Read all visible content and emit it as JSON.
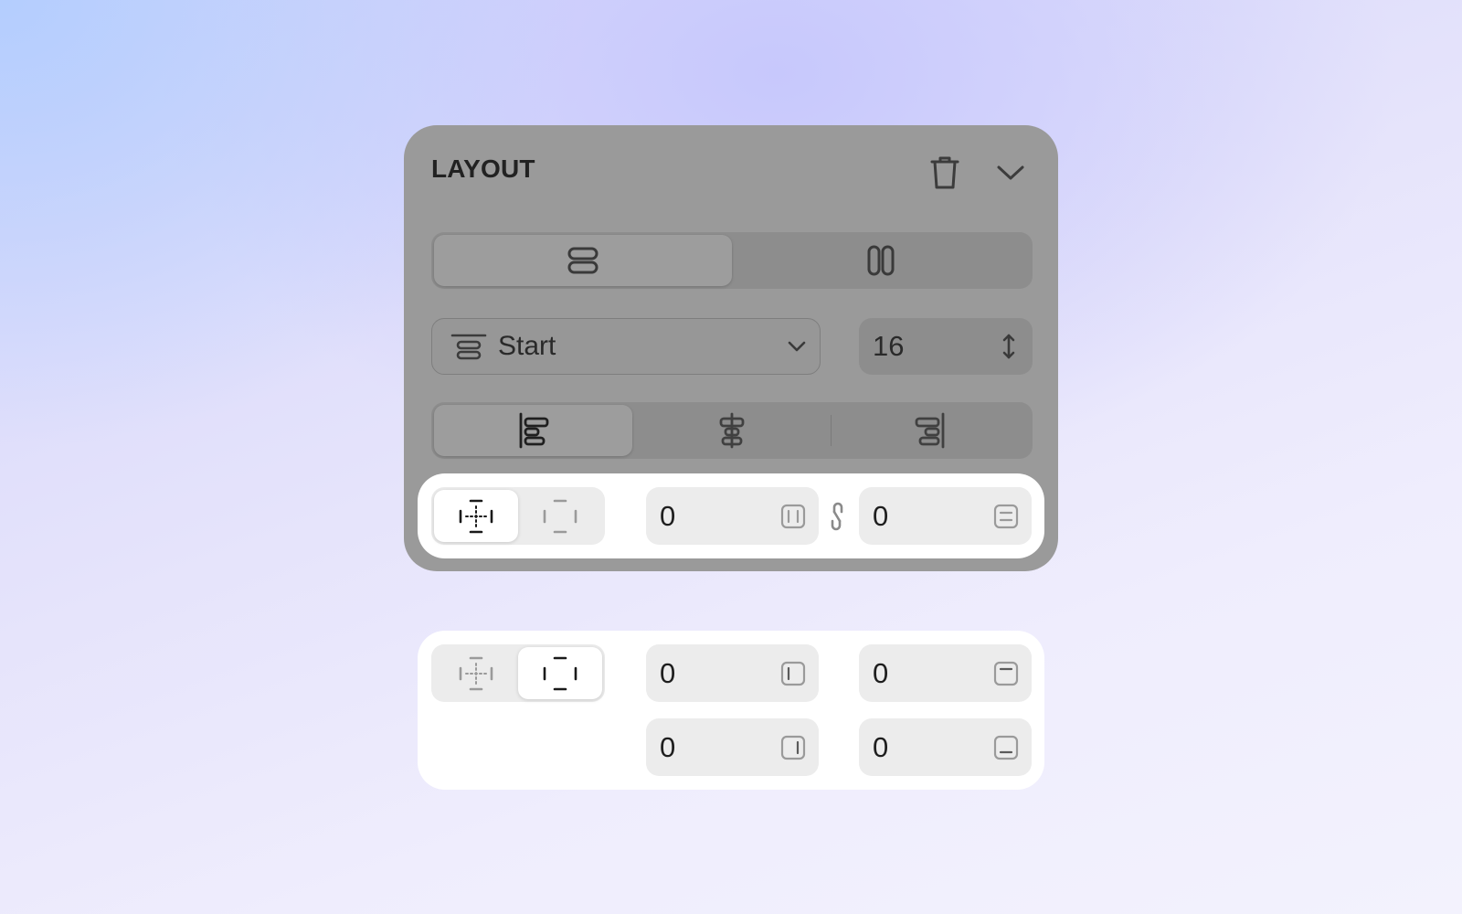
{
  "panel": {
    "title": "LAYOUT",
    "icons": {
      "delete": "trash-icon",
      "collapse": "chevron-down-icon"
    },
    "direction": {
      "options": [
        {
          "name": "vertical",
          "icon": "rows-icon",
          "active": true
        },
        {
          "name": "horizontal",
          "icon": "columns-icon",
          "active": false
        }
      ]
    },
    "distribution": {
      "selected": "Start",
      "icon": "distribute-start-icon"
    },
    "gap": {
      "value": "16",
      "icon": "vertical-resize-icon"
    },
    "alignment": {
      "options": [
        {
          "name": "left",
          "icon": "align-left-icon",
          "active": true
        },
        {
          "name": "center",
          "icon": "align-center-icon",
          "active": false
        },
        {
          "name": "right",
          "icon": "align-right-icon",
          "active": false
        }
      ]
    }
  },
  "padding_linked": {
    "mode": "linked",
    "horizontal": "0",
    "vertical": "0",
    "link_icon": "link-icon"
  },
  "padding_split": {
    "mode": "individual",
    "left": "0",
    "top": "0",
    "right": "0",
    "bottom": "0"
  },
  "colors": {
    "panel_bg": "#9a9a9a",
    "card_bg": "#ffffff",
    "field_bg": "#ececec",
    "text_dark": "#1f1f1f"
  }
}
